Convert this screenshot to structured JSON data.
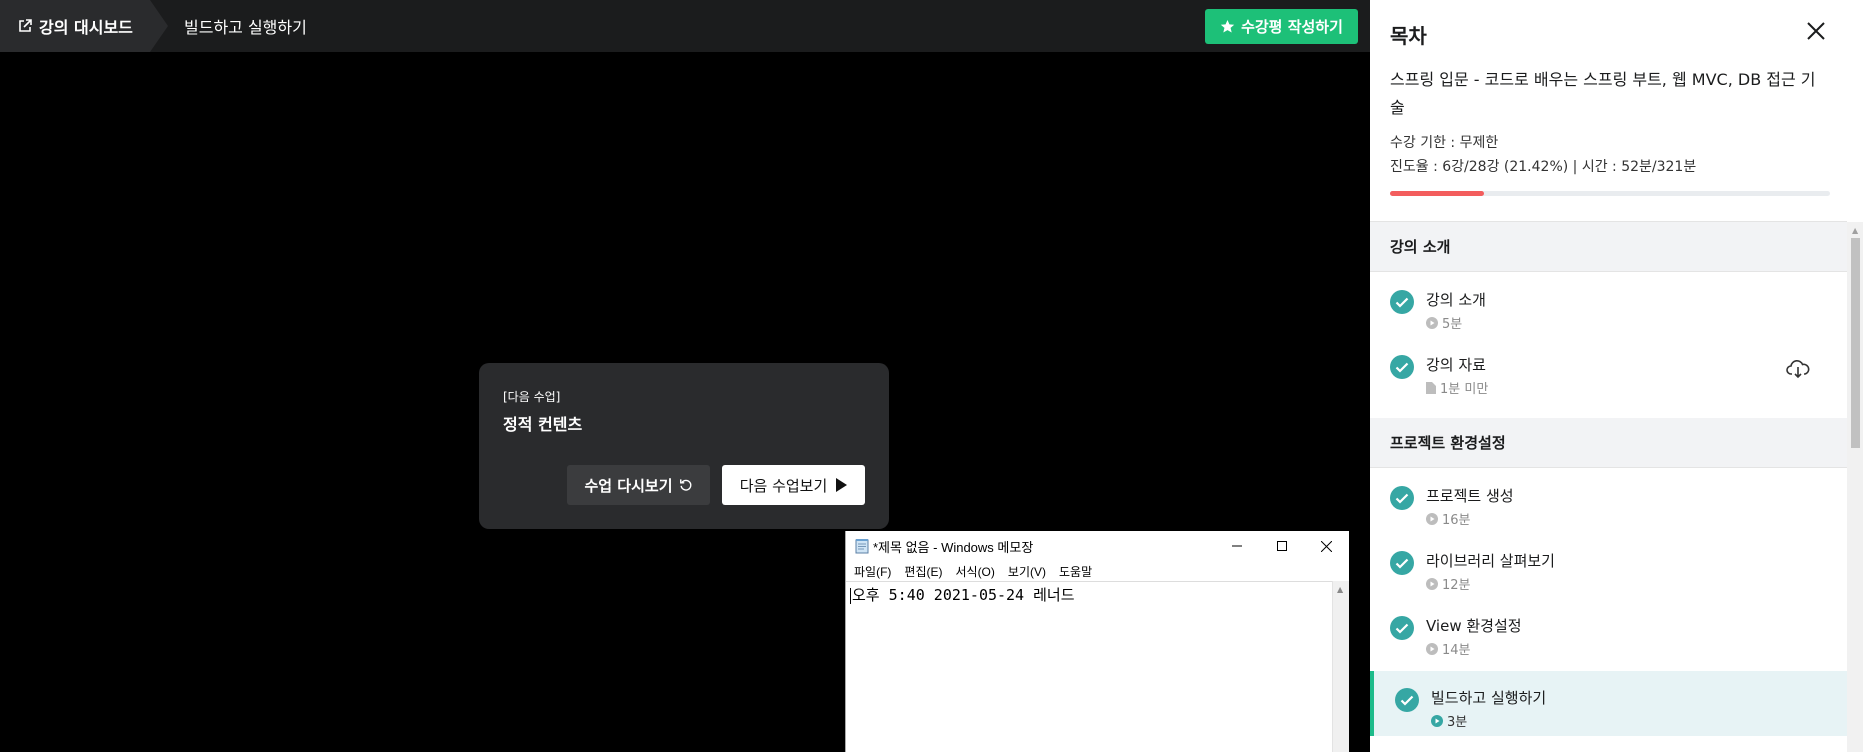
{
  "topbar": {
    "dashboard_label": "강의 대시보드",
    "lesson_title": "빌드하고 실행하기",
    "review_label": "수강평 작성하기"
  },
  "next_popup": {
    "label": "[다음 수업]",
    "title": "정적 컨텐츠",
    "replay_label": "수업 다시보기",
    "next_label": "다음 수업보기"
  },
  "notepad": {
    "title": "*제목 없음 - Windows 메모장",
    "menu": [
      "파일(F)",
      "편집(E)",
      "서식(O)",
      "보기(V)",
      "도움말"
    ],
    "content": "오후 5:40 2021-05-24 레너드"
  },
  "sidebar": {
    "title": "목차",
    "course_name": "스프링 입문 - 코드로 배우는 스프링 부트, 웹 MVC, DB 접근 기술",
    "limit": "수강 기한 : 무제한",
    "progress_text": "진도율 : 6강/28강 (21.42%) | 시간 : 52분/321분",
    "progress_fraction": 0.2142,
    "sections": [
      {
        "title": "강의 소개",
        "units": [
          {
            "title": "강의 소개",
            "meta": "5분",
            "type": "video"
          },
          {
            "title": "강의 자료",
            "meta": "1분 미만",
            "type": "file"
          }
        ]
      },
      {
        "title": "프로젝트 환경설정",
        "units": [
          {
            "title": "프로젝트 생성",
            "meta": "16분",
            "type": "video"
          },
          {
            "title": "라이브러리 살펴보기",
            "meta": "12분",
            "type": "video"
          },
          {
            "title": "View 환경설정",
            "meta": "14분",
            "type": "video"
          },
          {
            "title": "빌드하고 실행하기",
            "meta": "3분",
            "type": "video",
            "active": true
          }
        ]
      }
    ]
  },
  "colors": {
    "accent_green": "#1dc078",
    "check_teal": "#36a7a4",
    "progress_red": "#f35d5d"
  }
}
